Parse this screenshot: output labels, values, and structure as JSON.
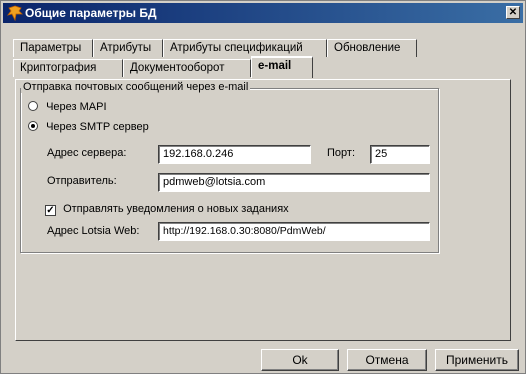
{
  "window": {
    "title": "Общие параметры БД",
    "close_glyph": "✕"
  },
  "tabs_row1": [
    "Параметры",
    "Атрибуты",
    "Атрибуты спецификаций",
    "Обновление"
  ],
  "tabs_row2": [
    "Криптография",
    "Документооборот",
    "e-mail"
  ],
  "active_tab": "e-mail",
  "group": {
    "label": "Отправка почтовых сообщений через e-mail",
    "radio_mapi": "Через MAPI",
    "radio_smtp": "Через SMTP сервер",
    "selected": "smtp",
    "server_label": "Адрес сервера:",
    "server_value": "192.168.0.246",
    "port_label": "Порт:",
    "port_value": "25",
    "sender_label": "Отправитель:",
    "sender_value": "pdmweb@lotsia.com",
    "notify_label": "Отправлять уведомления о новых заданиях",
    "notify_checked": true,
    "web_label": "Адрес Lotsia Web:",
    "web_value": "http://192.168.0.30:8080/PdmWeb/"
  },
  "buttons": {
    "ok": "Ok",
    "cancel": "Отмена",
    "apply": "Применить"
  },
  "colors": {
    "title_bar": "#0a246a",
    "face": "#d4d0c8",
    "icon": "#f0a020"
  }
}
